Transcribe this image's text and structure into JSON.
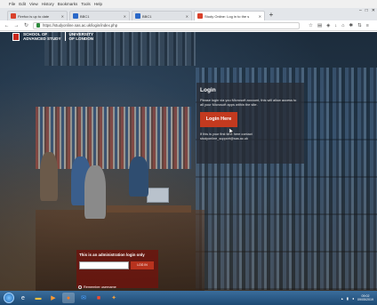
{
  "menubar": [
    "File",
    "Edit",
    "View",
    "History",
    "Bookmarks",
    "Tools",
    "Help"
  ],
  "tabs": [
    {
      "label": "Firefox is up to date",
      "icon": "firefox-icon",
      "active": false
    },
    {
      "label": "BBC1",
      "icon": "bbc-icon",
      "active": false
    },
    {
      "label": "BBC1",
      "icon": "bbc-icon",
      "active": false
    },
    {
      "label": "Study Online: Log in to the s",
      "icon": "site-icon",
      "active": true
    }
  ],
  "address": {
    "url": "https://studyonline.sas.ac.uk/login/index.php"
  },
  "logo": {
    "school": "SCHOOL OF\nADVANCED STUDY",
    "university": "UNIVERSITY\nOF LONDON"
  },
  "login": {
    "heading": "Login",
    "text": "Please login via you Microsoft account, this will allow access to all your Microsoft apps within the site.",
    "button": "Login Here",
    "note": "If this is your first time here contact studyonline_support@sas.ac.uk"
  },
  "admin": {
    "title": "This is an administration login only",
    "button": "LOG IN",
    "remember": "Remember username"
  },
  "taskbar": {
    "time": "09:02",
    "date": "09/05/2019"
  }
}
